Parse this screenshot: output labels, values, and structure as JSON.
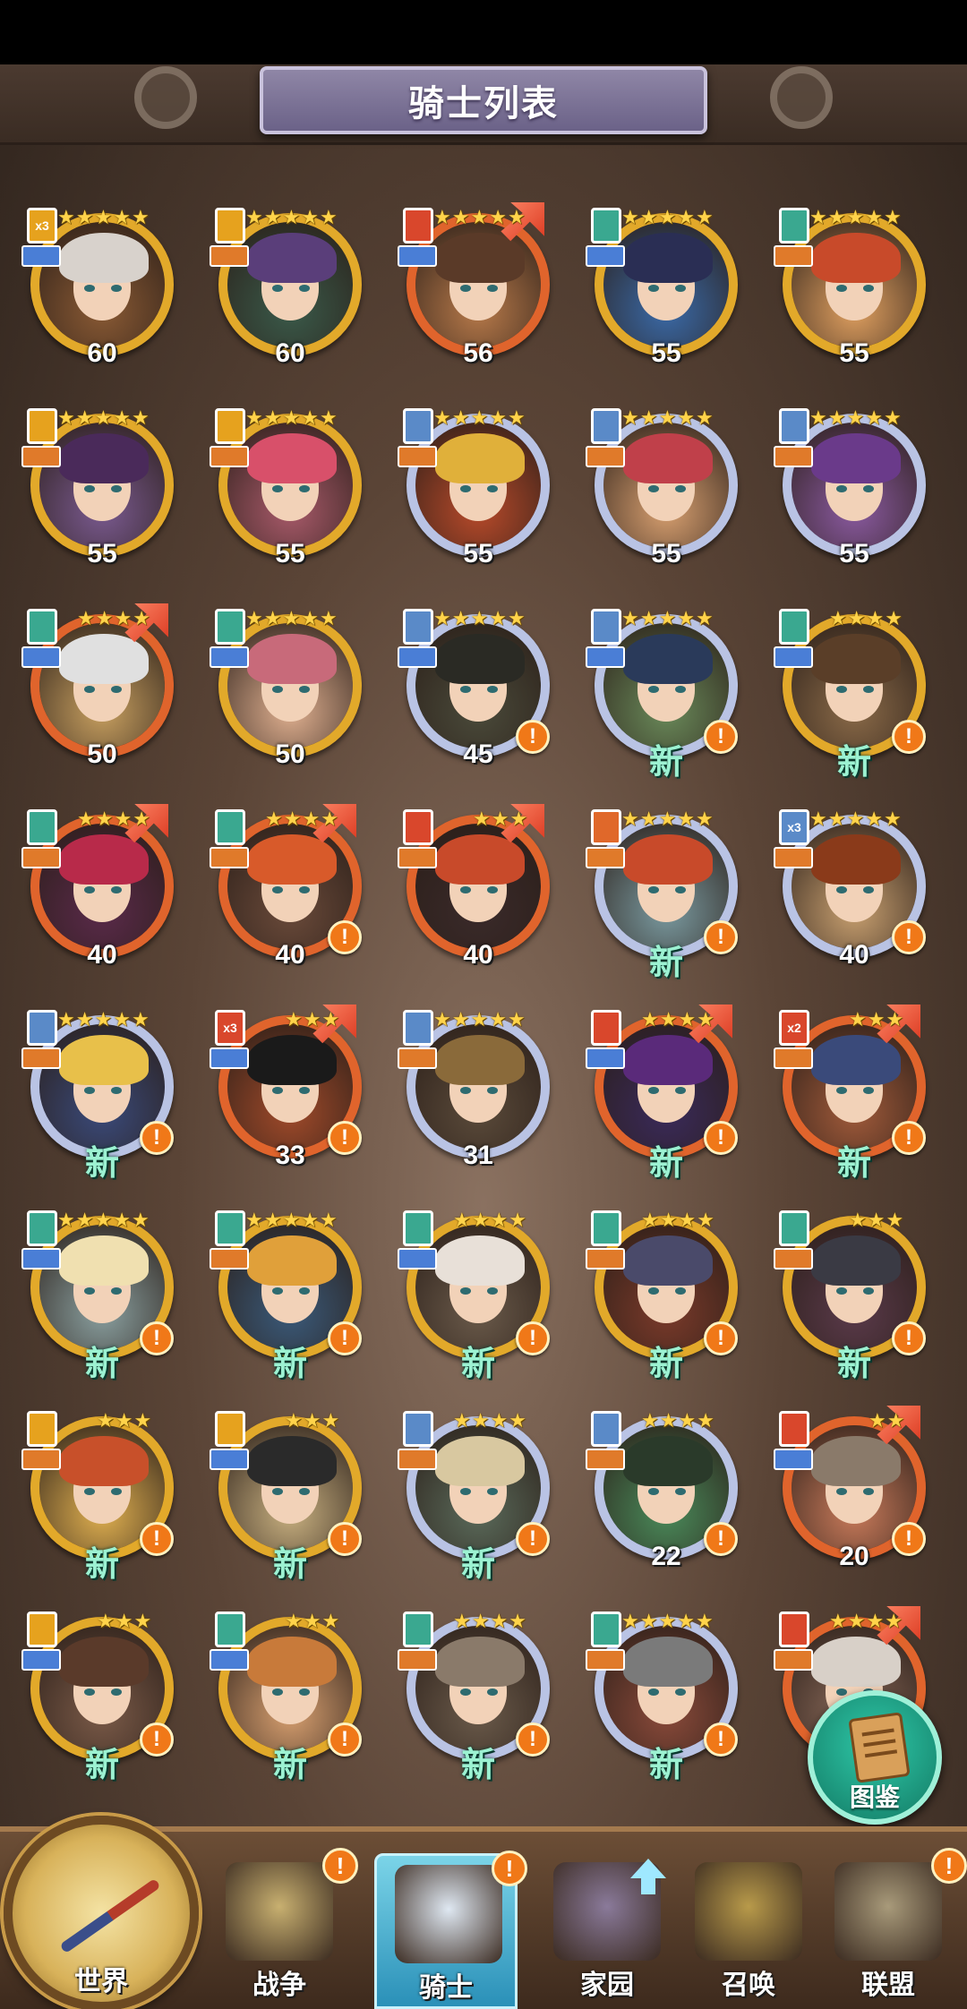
{
  "header": {
    "title": "骑士列表"
  },
  "knights": [
    {
      "level": "60",
      "stars": 5,
      "ring": "gold",
      "top": "yellow",
      "topText": "x3",
      "sub": "blue",
      "arrow": false,
      "alert": false,
      "hair": "#d8d2cc",
      "bg": "#8a5a34"
    },
    {
      "level": "60",
      "stars": 5,
      "ring": "gold",
      "top": "yellow",
      "topText": "",
      "sub": "orange",
      "arrow": false,
      "alert": false,
      "hair": "#5a3e7a",
      "bg": "#3a5a4a"
    },
    {
      "level": "56",
      "stars": 5,
      "ring": "red",
      "top": "red",
      "topText": "",
      "sub": "blue",
      "arrow": true,
      "alert": false,
      "hair": "#5a3a28",
      "bg": "#b87a4a"
    },
    {
      "level": "55",
      "stars": 5,
      "ring": "gold",
      "top": "teal",
      "topText": "",
      "sub": "blue",
      "arrow": false,
      "alert": false,
      "hair": "#2a2e54",
      "bg": "#3a6aa8"
    },
    {
      "level": "55",
      "stars": 5,
      "ring": "gold",
      "top": "teal",
      "topText": "",
      "sub": "orange",
      "arrow": false,
      "alert": false,
      "hair": "#c84a2a",
      "bg": "#e0a060"
    },
    {
      "level": "55",
      "stars": 5,
      "ring": "gold",
      "top": "yellow",
      "topText": "",
      "sub": "orange",
      "arrow": false,
      "alert": false,
      "hair": "#4a2a5a",
      "bg": "#7a5a90"
    },
    {
      "level": "55",
      "stars": 5,
      "ring": "gold",
      "top": "yellow",
      "topText": "",
      "sub": "orange",
      "arrow": false,
      "alert": false,
      "hair": "#d8506a",
      "bg": "#a85a6a"
    },
    {
      "level": "55",
      "stars": 5,
      "ring": "silver",
      "top": "blue",
      "topText": "",
      "sub": "orange",
      "arrow": false,
      "alert": false,
      "hair": "#e0b03a",
      "bg": "#b84a2a"
    },
    {
      "level": "55",
      "stars": 5,
      "ring": "silver",
      "top": "blue",
      "topText": "",
      "sub": "orange",
      "arrow": false,
      "alert": false,
      "hair": "#c0404a",
      "bg": "#d8a070"
    },
    {
      "level": "55",
      "stars": 5,
      "ring": "silver",
      "top": "blue",
      "topText": "",
      "sub": "orange",
      "arrow": false,
      "alert": false,
      "hair": "#6a3a8a",
      "bg": "#8a5aa0"
    },
    {
      "level": "50",
      "stars": 4,
      "ring": "red",
      "top": "teal",
      "topText": "",
      "sub": "blue",
      "arrow": true,
      "alert": false,
      "hair": "#e0e0e0",
      "bg": "#c8a060"
    },
    {
      "level": "50",
      "stars": 5,
      "ring": "gold",
      "top": "teal",
      "topText": "",
      "sub": "blue",
      "arrow": false,
      "alert": false,
      "hair": "#c86a7a",
      "bg": "#e0b090"
    },
    {
      "level": "45",
      "stars": 5,
      "ring": "silver",
      "top": "blue",
      "topText": "",
      "sub": "blue",
      "arrow": false,
      "alert": true,
      "hair": "#2a2a24",
      "bg": "#4a4a3a"
    },
    {
      "level": "新",
      "stars": 5,
      "ring": "silver",
      "top": "blue",
      "topText": "",
      "sub": "blue",
      "arrow": false,
      "alert": true,
      "hair": "#2a3a5a",
      "bg": "#6a8a5a"
    },
    {
      "level": "新",
      "stars": 4,
      "ring": "gold",
      "top": "teal",
      "topText": "",
      "sub": "blue",
      "arrow": false,
      "alert": true,
      "hair": "#5a3e28",
      "bg": "#8a6a48"
    },
    {
      "level": "40",
      "stars": 4,
      "ring": "red",
      "top": "teal",
      "topText": "",
      "sub": "orange",
      "arrow": true,
      "alert": false,
      "hair": "#b82a4a",
      "bg": "#5a2a4a"
    },
    {
      "level": "40",
      "stars": 4,
      "ring": "red",
      "top": "teal",
      "topText": "",
      "sub": "orange",
      "arrow": true,
      "alert": true,
      "hair": "#d85a2a",
      "bg": "#6a4a3a"
    },
    {
      "level": "40",
      "stars": 3,
      "ring": "red",
      "top": "red",
      "topText": "",
      "sub": "orange",
      "arrow": true,
      "alert": false,
      "hair": "#c84a2a",
      "bg": "#3a2a2a"
    },
    {
      "level": "新",
      "stars": 5,
      "ring": "silver",
      "top": "orange",
      "topText": "",
      "sub": "orange",
      "arrow": false,
      "alert": true,
      "hair": "#c84a2a",
      "bg": "#7a9aa0"
    },
    {
      "level": "40",
      "stars": 5,
      "ring": "silver",
      "top": "blue",
      "topText": "x3",
      "sub": "orange",
      "arrow": false,
      "alert": true,
      "hair": "#8a3a1a",
      "bg": "#c8a070"
    },
    {
      "level": "新",
      "stars": 5,
      "ring": "silver",
      "top": "blue",
      "topText": "",
      "sub": "orange",
      "arrow": false,
      "alert": true,
      "hair": "#e8c04a",
      "bg": "#3a4a7a"
    },
    {
      "level": "33",
      "stars": 3,
      "ring": "red",
      "top": "red",
      "topText": "x3",
      "sub": "blue",
      "arrow": true,
      "alert": true,
      "hair": "#1a1a1a",
      "bg": "#a04a2a"
    },
    {
      "level": "31",
      "stars": 5,
      "ring": "silver",
      "top": "blue",
      "topText": "",
      "sub": "orange",
      "arrow": false,
      "alert": false,
      "hair": "#8a6a3a",
      "bg": "#5a4a3a"
    },
    {
      "level": "新",
      "stars": 4,
      "ring": "red",
      "top": "red",
      "topText": "",
      "sub": "blue",
      "arrow": true,
      "alert": true,
      "hair": "#5a2a7a",
      "bg": "#3a2a5a"
    },
    {
      "level": "新",
      "stars": 3,
      "ring": "red",
      "top": "red",
      "topText": "x2",
      "sub": "orange",
      "arrow": true,
      "alert": true,
      "hair": "#3a4a7a",
      "bg": "#a05a3a"
    },
    {
      "level": "新",
      "stars": 5,
      "ring": "gold",
      "top": "teal",
      "topText": "",
      "sub": "blue",
      "arrow": false,
      "alert": true,
      "hair": "#f0e0b0",
      "bg": "#8aa0a0"
    },
    {
      "level": "新",
      "stars": 5,
      "ring": "gold",
      "top": "teal",
      "topText": "",
      "sub": "orange",
      "arrow": false,
      "alert": true,
      "hair": "#e0a03a",
      "bg": "#3a5a7a"
    },
    {
      "level": "新",
      "stars": 4,
      "ring": "gold",
      "top": "teal",
      "topText": "",
      "sub": "blue",
      "arrow": false,
      "alert": true,
      "hair": "#e8e0d8",
      "bg": "#6a5a4a"
    },
    {
      "level": "新",
      "stars": 4,
      "ring": "gold",
      "top": "teal",
      "topText": "",
      "sub": "orange",
      "arrow": false,
      "alert": true,
      "hair": "#4a4a6a",
      "bg": "#7a3a2a"
    },
    {
      "level": "新",
      "stars": 3,
      "ring": "gold",
      "top": "teal",
      "topText": "",
      "sub": "orange",
      "arrow": false,
      "alert": true,
      "hair": "#3a3a44",
      "bg": "#5a3a4a"
    },
    {
      "level": "新",
      "stars": 3,
      "ring": "gold",
      "top": "yellow",
      "topText": "",
      "sub": "orange",
      "arrow": false,
      "alert": true,
      "hair": "#c8502a",
      "bg": "#e0b050"
    },
    {
      "level": "新",
      "stars": 3,
      "ring": "gold",
      "top": "yellow",
      "topText": "",
      "sub": "blue",
      "arrow": false,
      "alert": true,
      "hair": "#2a2a2a",
      "bg": "#c8b080"
    },
    {
      "level": "新",
      "stars": 4,
      "ring": "silver",
      "top": "blue",
      "topText": "",
      "sub": "orange",
      "arrow": false,
      "alert": true,
      "hair": "#d8c8a0",
      "bg": "#5a6a5a"
    },
    {
      "level": "22",
      "stars": 4,
      "ring": "silver",
      "top": "blue",
      "topText": "",
      "sub": "orange",
      "arrow": false,
      "alert": true,
      "hair": "#2a3a2a",
      "bg": "#4a8a5a"
    },
    {
      "level": "20",
      "stars": 2,
      "ring": "red",
      "top": "red",
      "topText": "",
      "sub": "blue",
      "arrow": true,
      "alert": true,
      "hair": "#8a7a6a",
      "bg": "#c87a5a"
    },
    {
      "level": "新",
      "stars": 3,
      "ring": "gold",
      "top": "yellow",
      "topText": "",
      "sub": "blue",
      "arrow": false,
      "alert": true,
      "hair": "#5a3a2a",
      "bg": "#7a5a48"
    },
    {
      "level": "新",
      "stars": 3,
      "ring": "gold",
      "top": "teal",
      "topText": "",
      "sub": "blue",
      "arrow": false,
      "alert": true,
      "hair": "#c87a3a",
      "bg": "#d8a070"
    },
    {
      "level": "新",
      "stars": 4,
      "ring": "silver",
      "top": "teal",
      "topText": "",
      "sub": "orange",
      "arrow": false,
      "alert": true,
      "hair": "#8a7a6a",
      "bg": "#6a5a4a"
    },
    {
      "level": "新",
      "stars": 5,
      "ring": "silver",
      "top": "teal",
      "topText": "",
      "sub": "orange",
      "arrow": false,
      "alert": true,
      "hair": "#7a7a7a",
      "bg": "#8a4a3a"
    },
    {
      "level": "",
      "stars": 4,
      "ring": "red",
      "top": "red",
      "topText": "",
      "sub": "orange",
      "arrow": true,
      "alert": false,
      "hair": "#d8d0c8",
      "bg": "#8a6a5a"
    }
  ],
  "dex": {
    "label": "图鉴",
    "icon": "scroll-icon"
  },
  "nav": {
    "world": "世界",
    "tabs": [
      {
        "label": "战争",
        "icon": "map-icon",
        "alert": true,
        "active": false,
        "color": "#c8b070"
      },
      {
        "label": "骑士",
        "icon": "knight-icon",
        "alert": true,
        "active": true,
        "color": "#dfe8f2"
      },
      {
        "label": "家园",
        "icon": "house-icon",
        "alert": false,
        "active": false,
        "color": "#8a7a9a"
      },
      {
        "label": "召唤",
        "icon": "train-icon",
        "alert": false,
        "active": false,
        "color": "#b89a4a"
      },
      {
        "label": "联盟",
        "icon": "castle-icon",
        "alert": true,
        "active": false,
        "color": "#a89a7a"
      }
    ]
  }
}
